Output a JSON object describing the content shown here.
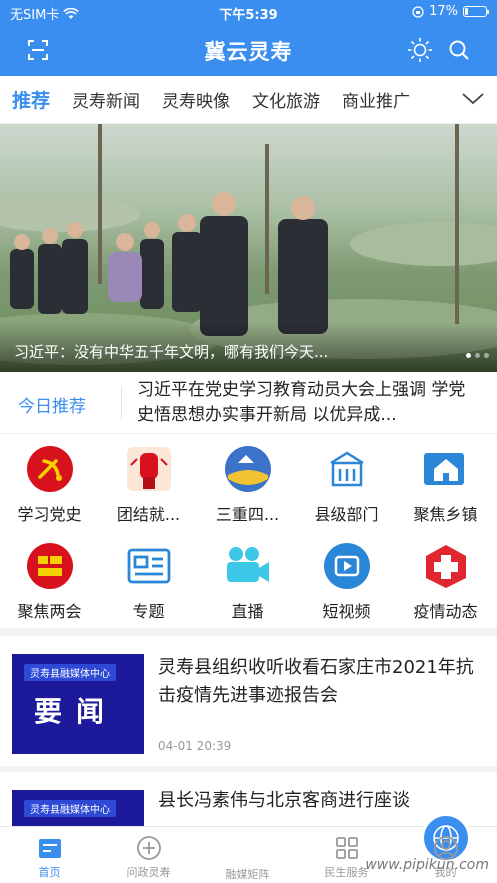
{
  "status_bar": {
    "carrier": "无SIM卡",
    "time": "下午5:39",
    "battery": "17%",
    "battery_level": 0.17
  },
  "header": {
    "title": "冀云灵寿",
    "icons": [
      "scan-icon",
      "sun-icon",
      "search-icon"
    ]
  },
  "tabs": [
    {
      "label": "推荐",
      "active": true
    },
    {
      "label": "灵寿新闻"
    },
    {
      "label": "灵寿映像"
    },
    {
      "label": "文化旅游"
    },
    {
      "label": "商业推广"
    }
  ],
  "hero": {
    "caption": "习近平：没有中华五千年文明，哪有我们今天..."
  },
  "today": {
    "label": "今日推荐",
    "text": "习近平在党史学习教育动员大会上强调 学党史悟思想办实事开新局 以优异成..."
  },
  "grid": [
    {
      "label": "学习党史",
      "icon": "party-emblem-icon"
    },
    {
      "label": "团结就...",
      "icon": "fist-icon"
    },
    {
      "label": "三重四...",
      "icon": "globe-image-icon"
    },
    {
      "label": "县级部门",
      "icon": "building-icon"
    },
    {
      "label": "聚焦乡镇",
      "icon": "house-icon"
    },
    {
      "label": "聚焦两会",
      "icon": "two-sessions-icon"
    },
    {
      "label": "专题",
      "icon": "topic-icon"
    },
    {
      "label": "直播",
      "icon": "video-camera-icon"
    },
    {
      "label": "短视频",
      "icon": "play-icon"
    },
    {
      "label": "疫情动态",
      "icon": "medical-cross-icon"
    }
  ],
  "news": [
    {
      "tag": "灵寿县融媒体中心",
      "thumb_title": "要闻",
      "headline": "灵寿县组织收听收看石家庄市2021年抗击疫情先进事迹报告会",
      "time": "04-01 20:39"
    },
    {
      "tag": "灵寿县融媒体中心",
      "headline": "县长冯素伟与北京客商进行座谈"
    }
  ],
  "tabbar": [
    {
      "label": "首页",
      "active": true,
      "icon": "home-icon"
    },
    {
      "label": "问政灵寿",
      "icon": "plus-circle-icon"
    },
    {
      "label": "融媒矩阵",
      "icon": "globe-icon"
    },
    {
      "label": "民生服务",
      "icon": "grid-icon"
    },
    {
      "label": "我的",
      "icon": "user-icon"
    }
  ],
  "watermark": "www.pipikun.com",
  "colors": {
    "brand": "#3a8ef0",
    "red": "#d8121c"
  }
}
